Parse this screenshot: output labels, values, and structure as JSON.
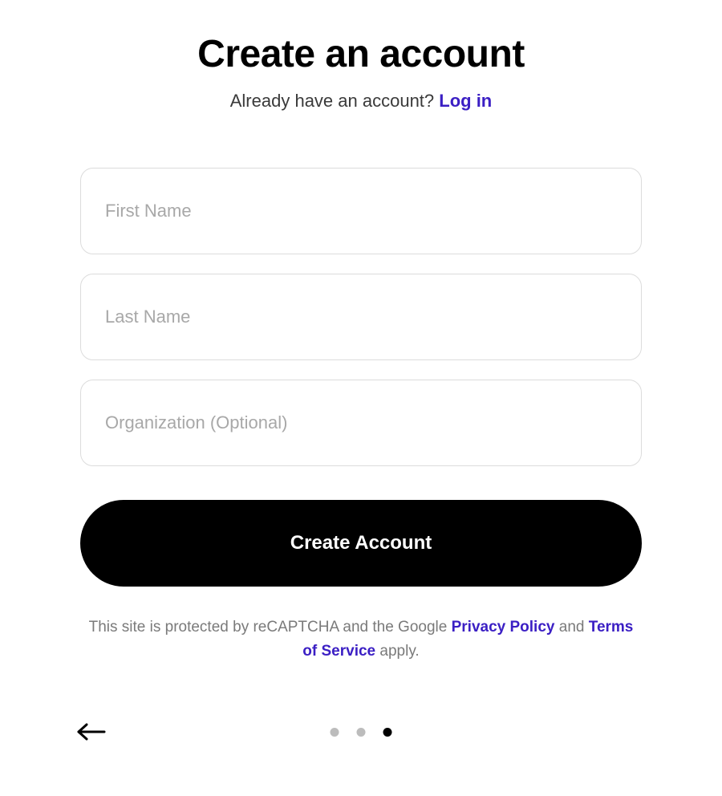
{
  "header": {
    "title": "Create an account",
    "subtitle_prefix": "Already have an account? ",
    "login_link": "Log in"
  },
  "form": {
    "first_name_placeholder": "First Name",
    "first_name_value": "",
    "last_name_placeholder": "Last Name",
    "last_name_value": "",
    "organization_placeholder": "Organization (Optional)",
    "organization_value": "",
    "submit_label": "Create Account"
  },
  "footer": {
    "recaptcha_prefix": "This site is protected by reCAPTCHA and the Google ",
    "privacy_policy": "Privacy Policy",
    "mid": " and ",
    "terms": "Terms of Service",
    "suffix": " apply."
  },
  "progress": {
    "total": 3,
    "active_index": 2
  }
}
